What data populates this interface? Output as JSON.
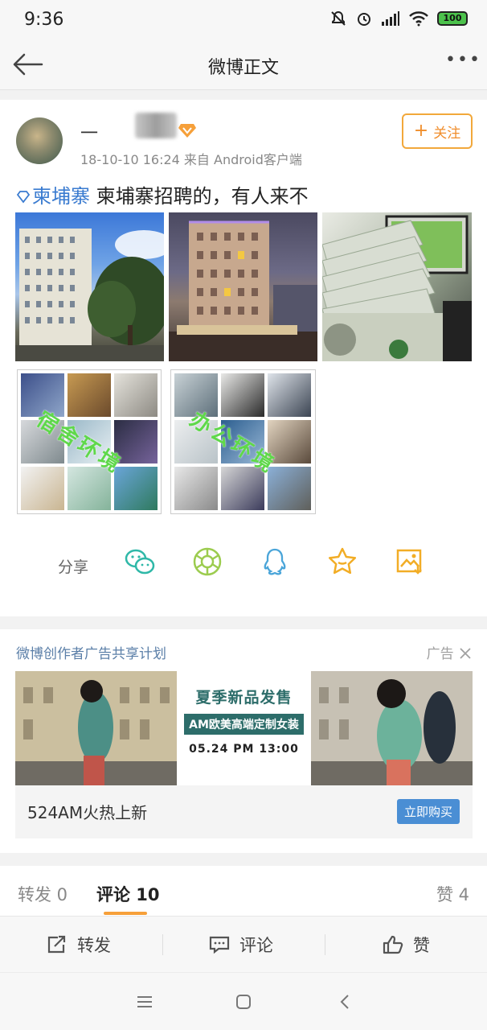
{
  "status_bar": {
    "time": "9:36",
    "battery": "100"
  },
  "nav": {
    "title": "微博正文",
    "more": "•••"
  },
  "post": {
    "username": "一",
    "meta": "18-10-10 16:24  来自 Android客户端",
    "follow_label": "关注",
    "follow_plus": "+",
    "topic": "柬埔寨",
    "text": " 柬埔寨招聘的，有人来不",
    "watermark_1": "宿舍环境",
    "watermark_2": "办公环境"
  },
  "share": {
    "label": "分享",
    "icons": [
      "wechat-icon",
      "moments-icon",
      "qq-icon",
      "favorite-star-icon",
      "save-image-icon"
    ]
  },
  "ad": {
    "title": "微博创作者广告共享计划",
    "tag": "广告",
    "headline": "夏季新品发售",
    "subhead": "AM欧美高端定制女装",
    "date": "05.24 PM 13:00",
    "caption": "524AM火热上新",
    "button": "立即购买"
  },
  "tabs": {
    "repost": "转发 0",
    "comment": "评论 10",
    "like": "赞 4"
  },
  "actions": {
    "repost": "转发",
    "comment": "评论",
    "like": "赞"
  },
  "colors": {
    "accent": "#f08e2c",
    "link": "#3a7bd0",
    "ad_button": "#4a8ed4",
    "tab_indicator": "#f6a03a"
  }
}
